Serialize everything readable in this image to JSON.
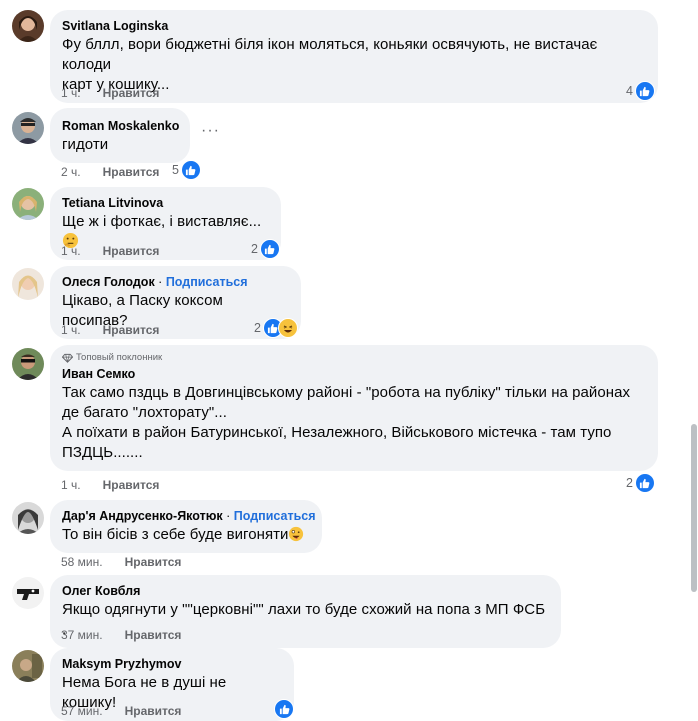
{
  "ui": {
    "like_label": "Нравится",
    "follow_label": "Подписаться",
    "more_label": "···"
  },
  "colors": {
    "like_blue": "#1877f2",
    "link_blue": "#216fdb",
    "bubble_bg": "#f0f2f5",
    "meta_gray": "#65676b"
  },
  "comments": [
    {
      "author": "Svitlana Loginska",
      "lines": [
        "Фу бллл, вори бюджетні біля ікон моляться, коньяки освячують, не вистачає колоди",
        "карт у кошику..."
      ],
      "time": "1 ч.",
      "reaction_count": "4",
      "reactions": [
        "like"
      ]
    },
    {
      "author": "Roman Moskalenko",
      "lines": [
        "гидоти"
      ],
      "time": "2 ч.",
      "reaction_count": "5",
      "reactions": [
        "like"
      ]
    },
    {
      "author": "Tetiana Litvinova",
      "lines": [
        "Ще ж і фоткає, і виставляє..."
      ],
      "time": "1 ч.",
      "reaction_count": "2",
      "reactions": [
        "like"
      ]
    },
    {
      "author": "Олеся Голодок",
      "follow": true,
      "lines": [
        "Цікаво, а Паску коксом посипав?"
      ],
      "time": "1 ч.",
      "reaction_count": "2",
      "reactions": [
        "like",
        "haha"
      ]
    },
    {
      "author": "Иван Семко",
      "badge": "Топовый поклонник",
      "lines": [
        "Так само пздць в Довгинцівському районі - \"робота на публіку\" тільки на районах",
        "де багато \"лохторату\"...",
        "А поїхати в район Батуринської, Незалежного, Військового містечка - там тупо",
        "ПЗДЦЬ......."
      ],
      "time": "1 ч.",
      "reaction_count": "2",
      "reactions": [
        "like"
      ]
    },
    {
      "author": "Дар'я Андрусенко-Якотюк",
      "follow": true,
      "lines": [
        "То він бісів з себе буде вигоняти"
      ],
      "time": "58 мин."
    },
    {
      "author": "Олег Ковбля",
      "lines": [
        "Якщо одягнути у \"\"церковні\"\" лахи то буде схожий на попа з МП ФСБ ."
      ],
      "time": "37 мин."
    },
    {
      "author": "Maksym Pryzhymov",
      "lines": [
        "Нема Бога не в душі не кошику!"
      ],
      "time": "57 мин."
    }
  ]
}
